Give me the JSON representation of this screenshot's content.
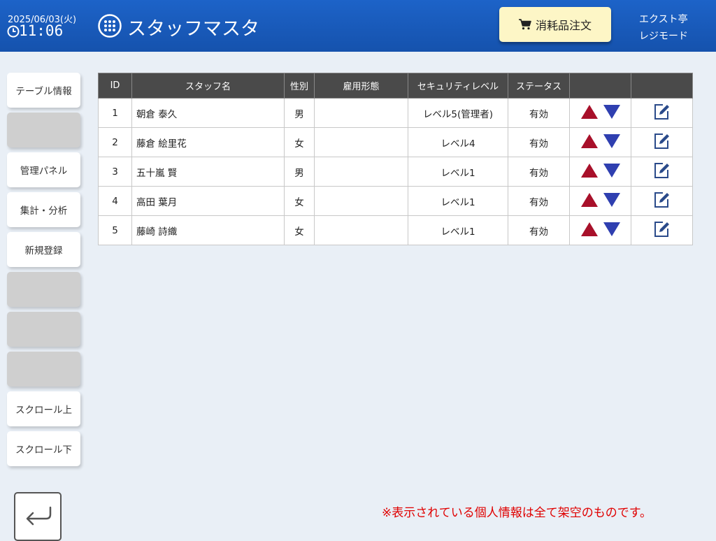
{
  "header": {
    "date": "2025/06/03(火)",
    "time": "11:06",
    "title": "スタッフマスタ",
    "order_button": "消耗品注文",
    "shop_name": "エクスト亭",
    "mode": "レジモード",
    "icons": [
      "clock-icon",
      "grid-menu-icon",
      "cart-icon"
    ],
    "colors": {
      "bar": "#1d63c8",
      "order_button": "#fdf6c6"
    }
  },
  "sidebar": {
    "items": [
      {
        "label": "テーブル情報"
      },
      {
        "label": ""
      },
      {
        "label": "管理パネル"
      },
      {
        "label": "集計・分析"
      },
      {
        "label": "新規登録"
      },
      {
        "label": ""
      },
      {
        "label": ""
      },
      {
        "label": ""
      },
      {
        "label": "スクロール上"
      },
      {
        "label": "スクロール下"
      }
    ],
    "back_icon": "return-arrow-icon"
  },
  "table": {
    "columns": [
      "ID",
      "スタッフ名",
      "性別",
      "雇用形態",
      "セキュリティレベル",
      "ステータス",
      "",
      ""
    ],
    "rows": [
      {
        "id": "1",
        "name": "朝倉 泰久",
        "gender": "男",
        "employment": "",
        "security": "レベル5(管理者)",
        "status": "有効"
      },
      {
        "id": "2",
        "name": "藤倉 絵里花",
        "gender": "女",
        "employment": "",
        "security": "レベル4",
        "status": "有効"
      },
      {
        "id": "3",
        "name": "五十嵐 賢",
        "gender": "男",
        "employment": "",
        "security": "レベル1",
        "status": "有効"
      },
      {
        "id": "4",
        "name": "高田 葉月",
        "gender": "女",
        "employment": "",
        "security": "レベル1",
        "status": "有効"
      },
      {
        "id": "5",
        "name": "藤崎 詩織",
        "gender": "女",
        "employment": "",
        "security": "レベル1",
        "status": "有効"
      }
    ],
    "row_icons": [
      "up-arrow-icon",
      "down-arrow-icon",
      "edit-icon"
    ],
    "colors": {
      "up_arrow": "#a8102a",
      "down_arrow": "#2f3fb0",
      "header": "#4a4a4a"
    }
  },
  "notice": "※表示されている個人情報は全て架空のものです。"
}
